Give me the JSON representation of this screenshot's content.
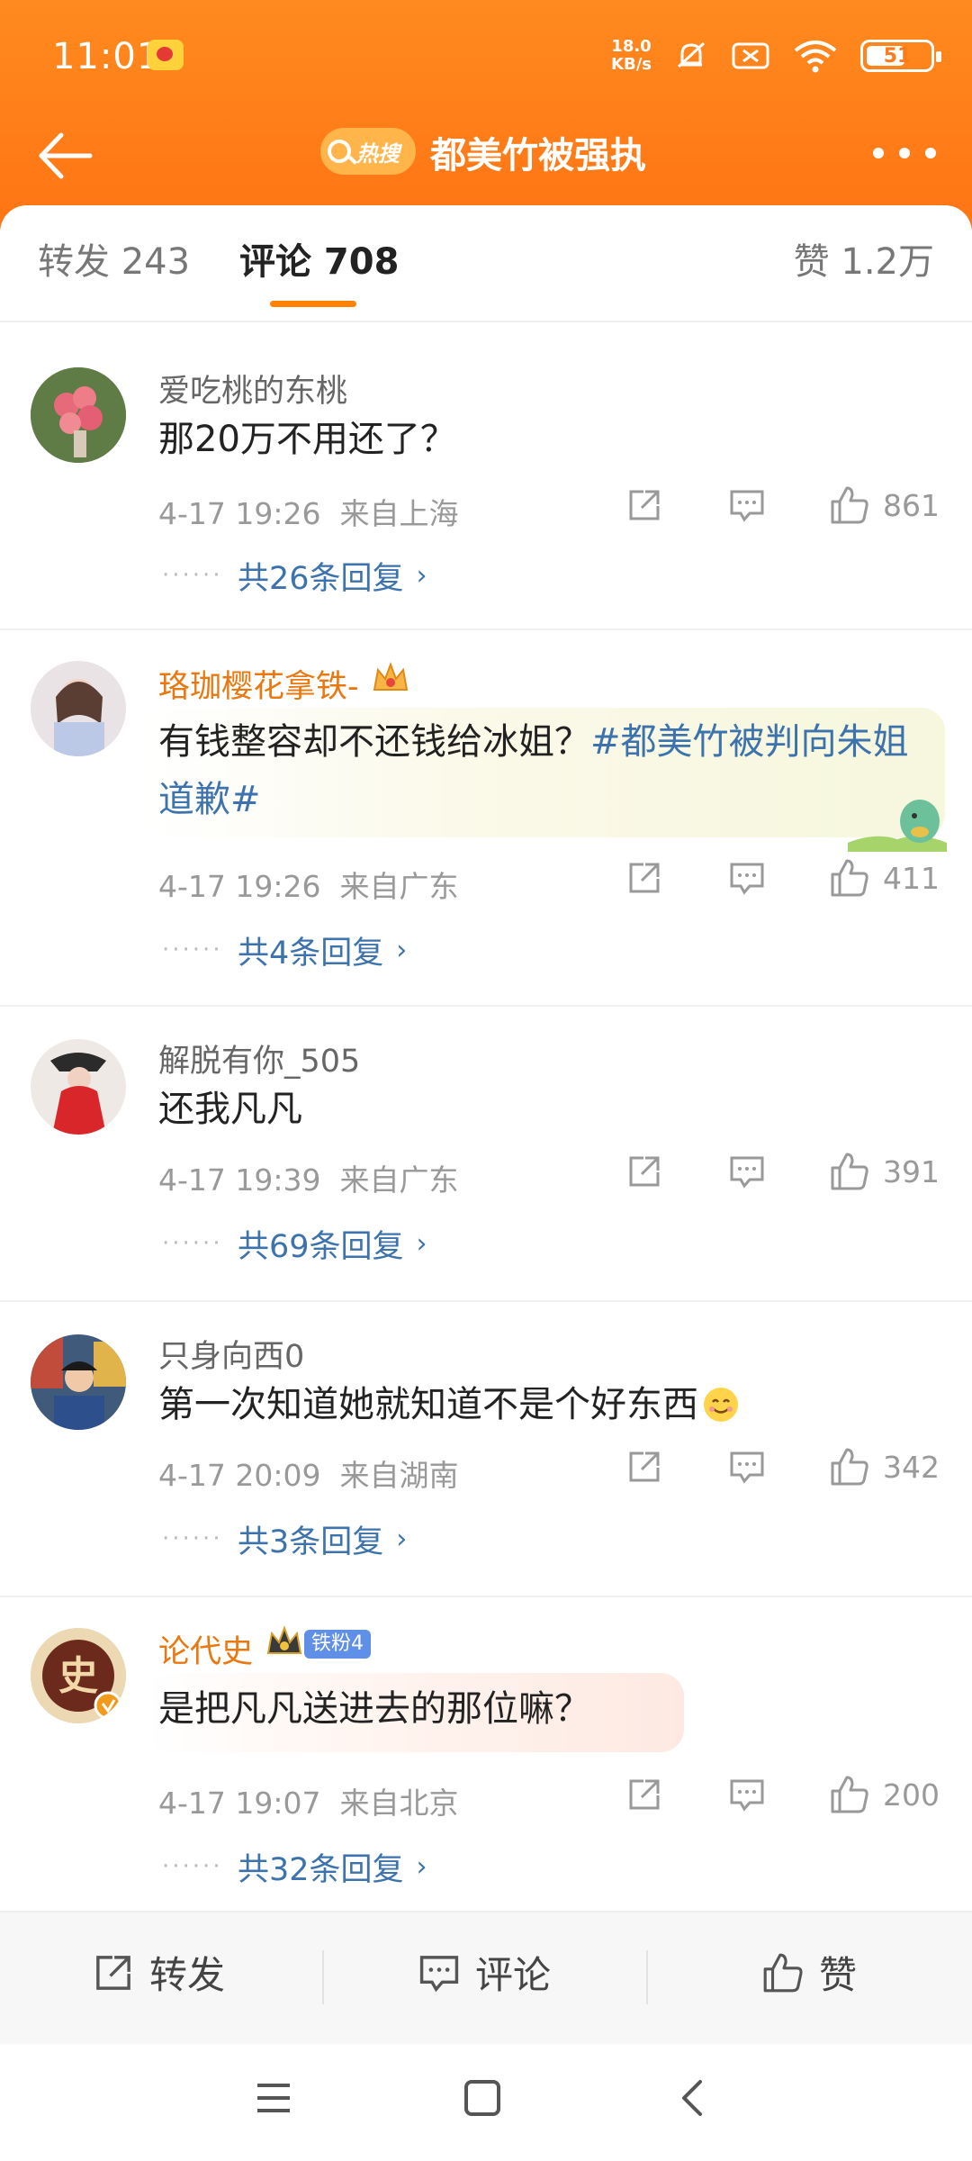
{
  "status_bar": {
    "time": "11:01",
    "net_speed_top": "18.0",
    "net_speed_bottom": "KB/s",
    "battery": "51"
  },
  "nav": {
    "hot_label": "热搜",
    "title": "都美竹被强执"
  },
  "tabs": [
    {
      "label": "转发 243"
    },
    {
      "label": "评论 708"
    },
    {
      "label": "赞 1.2万"
    }
  ],
  "comments": [
    {
      "username": "爱吃桃的东桃",
      "text": "那20万不用还了？",
      "time": "4-17 19:26",
      "location": "来自上海",
      "likes": "861",
      "replies": "共26条回复"
    },
    {
      "username": "珞珈樱花拿铁-",
      "text_plain": "有钱整容却不还钱给冰姐？",
      "text_hashtag": "#都美竹被判向朱姐道歉#",
      "time": "4-17 19:26",
      "location": "来自广东",
      "likes": "411",
      "replies": "共4条回复"
    },
    {
      "username": "解脱有你_505",
      "text": "还我凡凡",
      "time": "4-17 19:39",
      "location": "来自广东",
      "likes": "391",
      "replies": "共69条回复"
    },
    {
      "username": "只身向西0",
      "text": "第一次知道她就知道不是个好东西",
      "time": "4-17 20:09",
      "location": "来自湖南",
      "likes": "342",
      "replies": "共3条回复"
    },
    {
      "username": "论代史",
      "fan_badge": "铁粉4",
      "avatar_char": "史",
      "text": "是把凡凡送进去的那位嘛？",
      "time": "4-17 19:07",
      "location": "来自北京",
      "likes": "200",
      "replies": "共32条回复"
    }
  ],
  "bottom_bar": {
    "repost": "转发",
    "comment": "评论",
    "like": "赞"
  },
  "colors": {
    "header_orange": "#ff7a18",
    "accent": "#ff8200",
    "link_blue": "#3d73ad",
    "vip_name": "#e8780f"
  }
}
